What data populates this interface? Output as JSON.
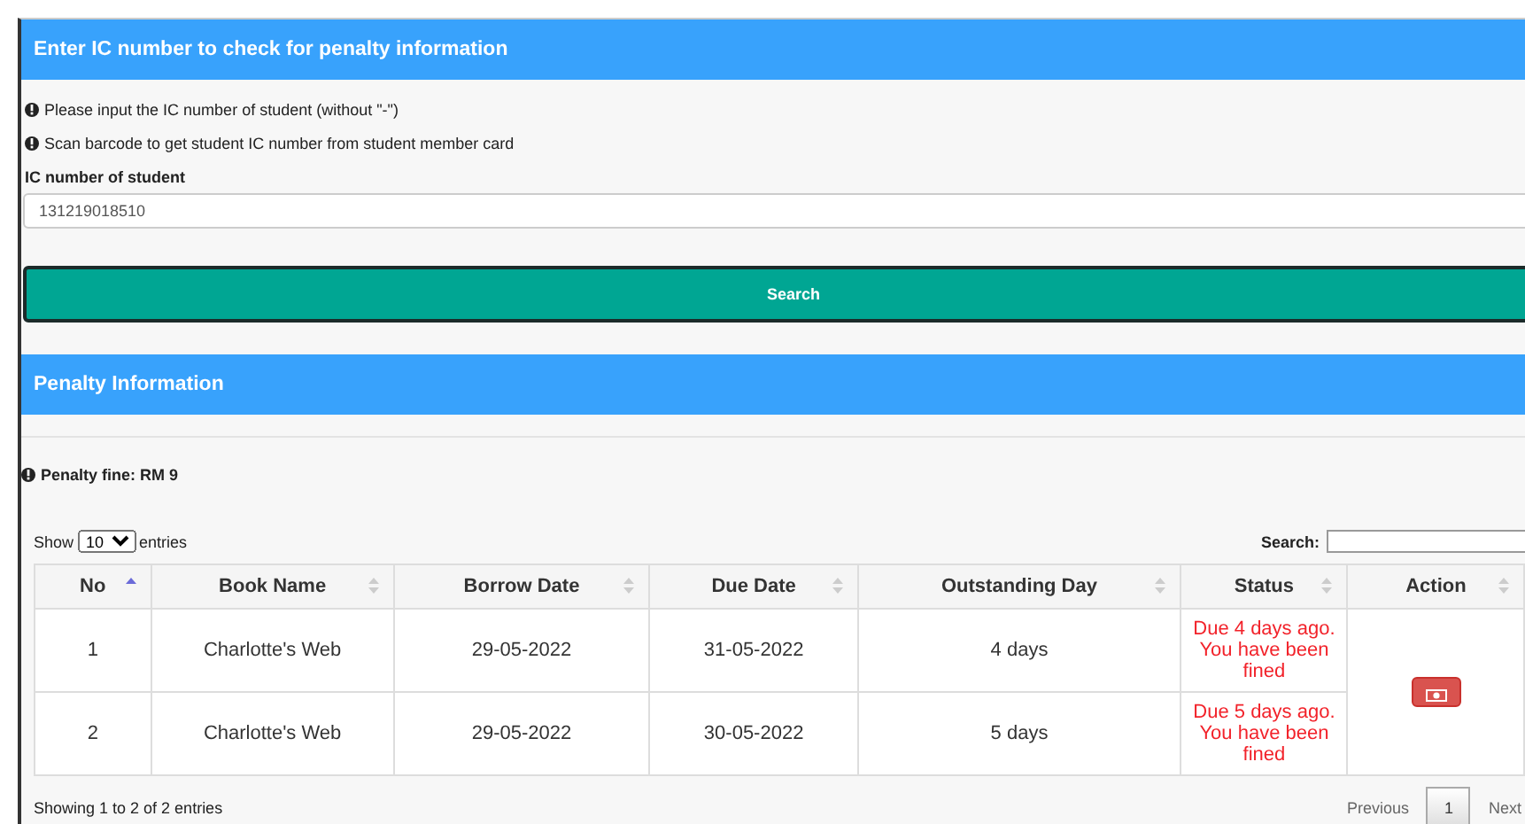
{
  "check_panel": {
    "title": "Enter IC number to check for penalty information",
    "notes": [
      "Please input the IC number of student (without \"-\")",
      "Scan barcode to get student IC number from student member card"
    ],
    "field_label": "IC number of student",
    "ic_field": {
      "value": "131219018510"
    },
    "search_button": "Search"
  },
  "penalty_panel": {
    "title": "Penalty Information",
    "fine": "Penalty fine: RM 9",
    "length_menu": {
      "before": "Show",
      "value": "10",
      "after": "entries"
    },
    "search_label": "Search:",
    "table": {
      "columns": [
        {
          "label": "No",
          "sorted": true
        },
        {
          "label": "Book Name",
          "sorted": false
        },
        {
          "label": "Borrow Date",
          "sorted": false
        },
        {
          "label": "Due Date",
          "sorted": false
        },
        {
          "label": "Outstanding Day",
          "sorted": false
        },
        {
          "label": "Status",
          "sorted": false
        },
        {
          "label": "Action",
          "sorted": false
        }
      ],
      "rows": [
        {
          "no": "1",
          "book": "Charlotte's Web",
          "borrow": "29-05-2022",
          "due": "31-05-2022",
          "outstanding": "4 days",
          "status": "Due 4 days ago. You have been fined"
        },
        {
          "no": "2",
          "book": "Charlotte's Web",
          "borrow": "29-05-2022",
          "due": "30-05-2022",
          "outstanding": "5 days",
          "status": "Due 5 days ago. You have been fined"
        }
      ]
    },
    "info": "Showing 1 to 2 of 2 entries",
    "pagination": [
      {
        "label": "Previous",
        "selected": false
      },
      {
        "label": "1",
        "selected": true
      },
      {
        "label": "Next",
        "selected": false
      }
    ]
  }
}
